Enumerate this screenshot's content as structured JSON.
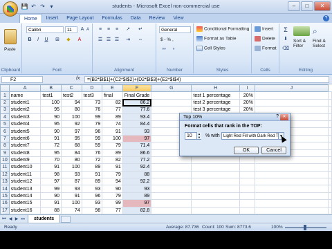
{
  "window": {
    "title": "students - Microsoft Excel non-commercial use",
    "controls": [
      "–",
      "□",
      "✕"
    ]
  },
  "qat": [
    "💾",
    "↶",
    "↷",
    "▾"
  ],
  "ribbon": {
    "tabs": [
      "Home",
      "Insert",
      "Page Layout",
      "Formulas",
      "Data",
      "Review",
      "View"
    ],
    "active_tab": "Home",
    "clipboard": {
      "paste": "Paste",
      "label": "Clipboard"
    },
    "font": {
      "name": "Calibri",
      "size": "11",
      "label": "Font"
    },
    "alignment": {
      "label": "Alignment"
    },
    "number": {
      "format": "General",
      "currency": "$ - % ,",
      "label": "Number"
    },
    "styles": {
      "conditional": "Conditional Formatting",
      "as_table": "Format as Table",
      "cell_styles": "Cell Styles",
      "label": "Styles"
    },
    "cells": {
      "insert": "Insert",
      "delete": "Delete",
      "format": "Format",
      "label": "Cells"
    },
    "editing": {
      "sort": "Sort &",
      "filter": "Filter",
      "find": "Find &",
      "select": "Select",
      "label": "Editing"
    }
  },
  "formula_bar": {
    "name_box": "F2",
    "fx": "fx",
    "formula": "=(B2*$I$1)+(C2*$I$2)+(D2*$I$3)+(E2*$I$4)"
  },
  "grid": {
    "columns": [
      "A",
      "B",
      "C",
      "D",
      "E",
      "F",
      "G",
      "H",
      "I",
      "J"
    ],
    "rows": [
      [
        "name",
        "test1",
        "test2",
        "test3",
        "final",
        "Final Grade",
        "",
        "test 1 percentage",
        "20%",
        ""
      ],
      [
        "student1",
        "100",
        "94",
        "73",
        "82",
        "86.2",
        "",
        "test 2 percentage",
        "20%",
        ""
      ],
      [
        "student2",
        "95",
        "80",
        "76",
        "77",
        "77.6",
        "",
        "test 3 percentage",
        "20%",
        ""
      ],
      [
        "student3",
        "90",
        "100",
        "99",
        "89",
        "93.4",
        "",
        "",
        "",
        ""
      ],
      [
        "student4",
        "95",
        "92",
        "79",
        "74",
        "84.4",
        "",
        "",
        "",
        ""
      ],
      [
        "student5",
        "90",
        "97",
        "96",
        "91",
        "93",
        "",
        "",
        "",
        ""
      ],
      [
        "student6",
        "91",
        "95",
        "99",
        "100",
        "97",
        "",
        "",
        "",
        ""
      ],
      [
        "student7",
        "72",
        "68",
        "59",
        "79",
        "71.4",
        "",
        "",
        "",
        ""
      ],
      [
        "student8",
        "95",
        "84",
        "76",
        "89",
        "86.6",
        "",
        "",
        "",
        ""
      ],
      [
        "student9",
        "70",
        "80",
        "72",
        "82",
        "77.2",
        "",
        "",
        "",
        ""
      ],
      [
        "student10",
        "91",
        "100",
        "89",
        "91",
        "92.4",
        "",
        "",
        "",
        ""
      ],
      [
        "student11",
        "98",
        "93",
        "91",
        "79",
        "88",
        "",
        "",
        "",
        ""
      ],
      [
        "student12",
        "97",
        "87",
        "89",
        "94",
        "92.2",
        "",
        "",
        "",
        ""
      ],
      [
        "student13",
        "99",
        "93",
        "93",
        "90",
        "93",
        "",
        "",
        "",
        ""
      ],
      [
        "student14",
        "90",
        "91",
        "96",
        "79",
        "89",
        "",
        "",
        "",
        ""
      ],
      [
        "student15",
        "91",
        "100",
        "93",
        "99",
        "97",
        "",
        "",
        "",
        ""
      ],
      [
        "student16",
        "88",
        "74",
        "98",
        "77",
        "82.8",
        "",
        "",
        "",
        ""
      ]
    ],
    "highlighted_rows": [
      6,
      15
    ]
  },
  "sheet_tabs": {
    "active": "students"
  },
  "status": {
    "ready": "Ready",
    "average": "Average: 87.736",
    "count": "Count: 100",
    "sum": "Sum: 8773.6",
    "zoom": "100%"
  },
  "dialog": {
    "title": "Top 10%",
    "help": "?",
    "close": "✕",
    "prompt": "Format cells that rank in the TOP:",
    "value": "10",
    "with_label": "% with",
    "format": "Light Red Fill with Dark Red Text",
    "ok": "OK",
    "cancel": "Cancel"
  },
  "colors": {
    "ribbon_bg": "#d8e6f7",
    "highlight_fill": "#e5b8be",
    "selection_fill": "#dfe9f6"
  }
}
